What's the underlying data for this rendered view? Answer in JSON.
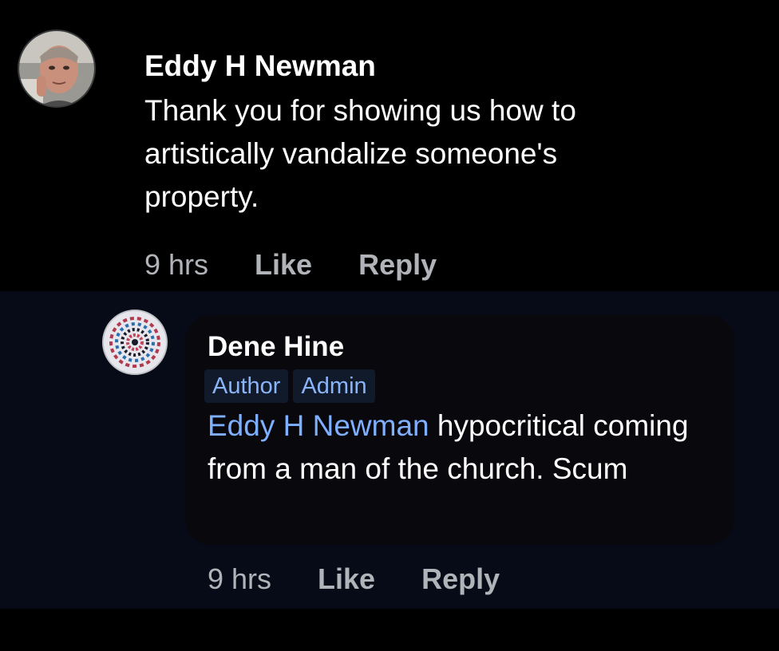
{
  "comments": [
    {
      "author": "Eddy H Newman",
      "text": "Thank you for showing us how to artistically vandalize someone's property.",
      "time": "9 hrs",
      "like_label": "Like",
      "reply_label": "Reply",
      "avatar_icon": "profile-photo"
    }
  ],
  "reply": {
    "author": "Dene Hine",
    "badges": [
      "Author",
      "Admin"
    ],
    "mention": "Eddy H Newman",
    "text": " hypocritical coming from a man of the church. Scum",
    "time": "9 hrs",
    "like_label": "Like",
    "reply_label": "Reply",
    "avatar_icon": "mandala-pattern"
  },
  "colors": {
    "background": "#000000",
    "reply_background": "#070b17",
    "bubble": "#08080d",
    "mention": "#7fb0ff",
    "badge_text": "#8ab4f8",
    "muted": "#b0b3b8"
  }
}
